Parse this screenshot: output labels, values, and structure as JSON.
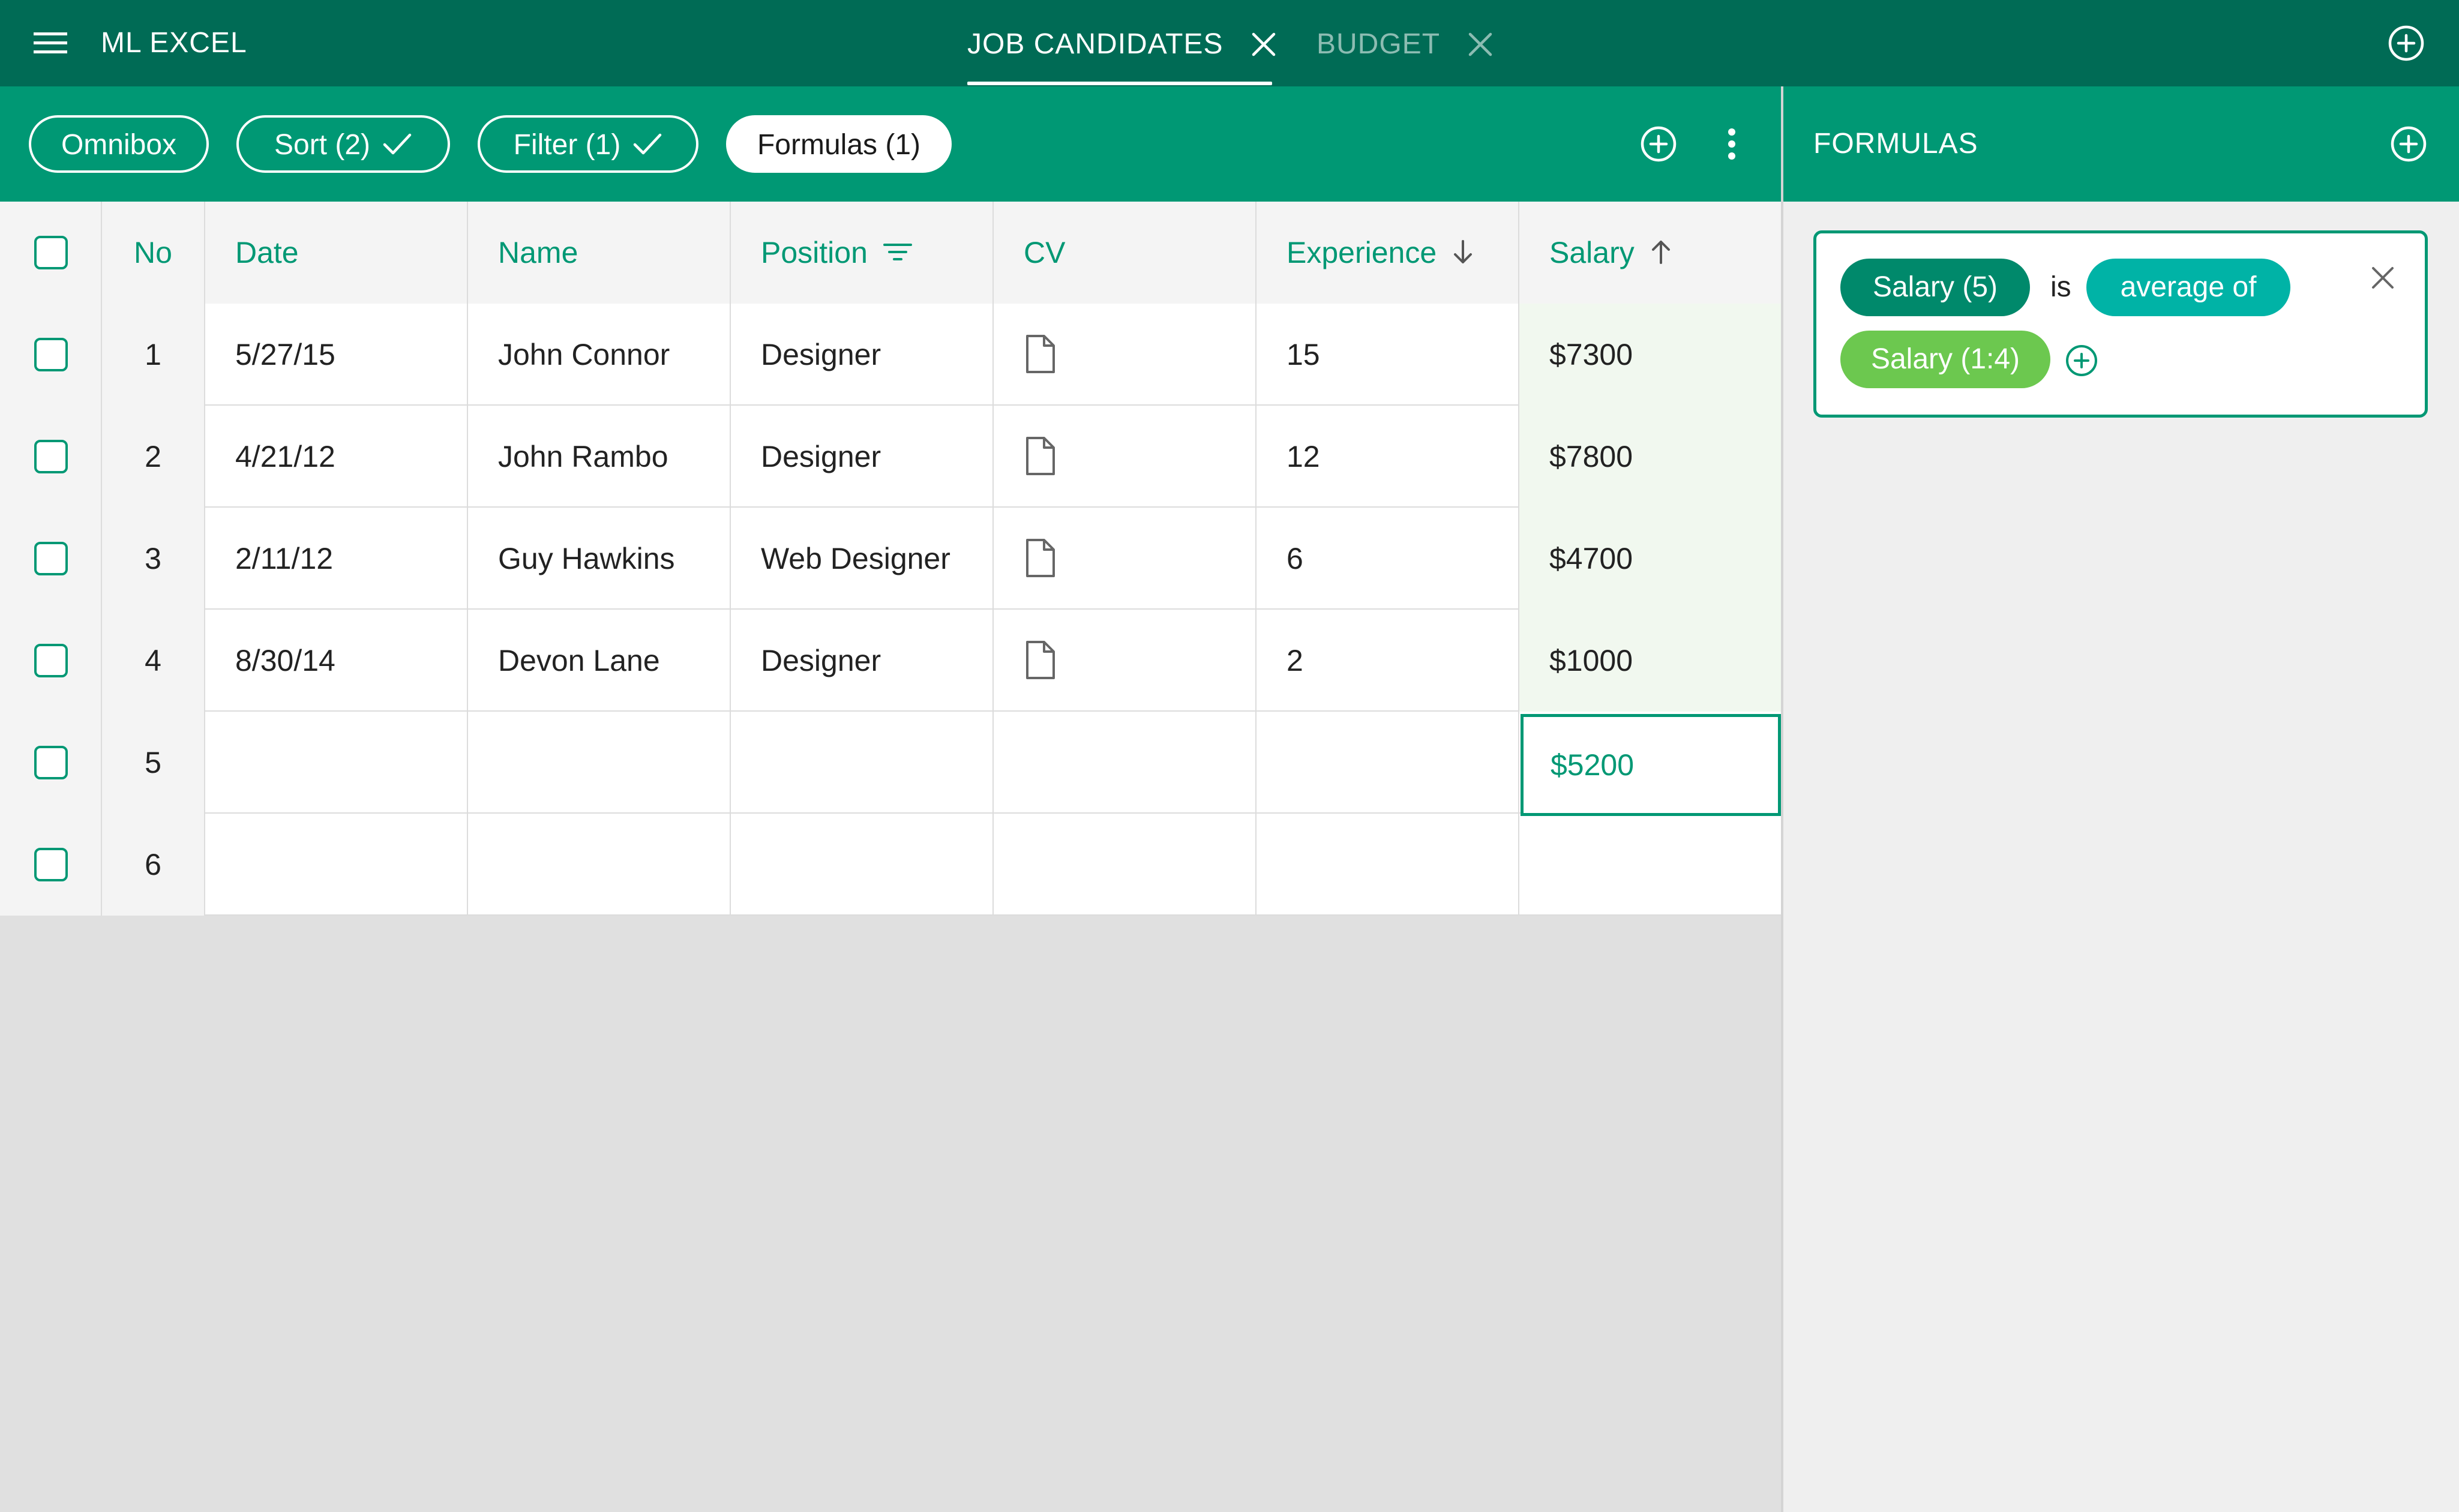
{
  "app": {
    "title": "ML EXCEL"
  },
  "tabs": [
    {
      "label": "JOB CANDIDATES",
      "active": true
    },
    {
      "label": "BUDGET",
      "active": false
    }
  ],
  "toolbar": {
    "omnibox_label": "Omnibox",
    "sort_label": "Sort (2)",
    "filter_label": "Filter (1)",
    "formulas_label": "Formulas (1)"
  },
  "table": {
    "columns": [
      "No",
      "Date",
      "Name",
      "Position",
      "CV",
      "Experience",
      "Salary"
    ],
    "rows": [
      {
        "no": "1",
        "date": "5/27/15",
        "name": "John Connor",
        "position": "Designer",
        "experience": "15",
        "salary": "$7300"
      },
      {
        "no": "2",
        "date": "4/21/12",
        "name": "John Rambo",
        "position": "Designer",
        "experience": "12",
        "salary": "$7800"
      },
      {
        "no": "3",
        "date": "2/11/12",
        "name": "Guy Hawkins",
        "position": "Web Designer",
        "experience": "6",
        "salary": "$4700"
      },
      {
        "no": "4",
        "date": "8/30/14",
        "name": "Devon Lane",
        "position": "Designer",
        "experience": "2",
        "salary": "$1000"
      },
      {
        "no": "5",
        "date": "",
        "name": "",
        "position": "",
        "experience": "",
        "salary": "$5200"
      },
      {
        "no": "6",
        "date": "",
        "name": "",
        "position": "",
        "experience": "",
        "salary": ""
      }
    ]
  },
  "formulas_panel": {
    "title": "FORMULAS",
    "formula": {
      "target": "Salary (5)",
      "connector": "is",
      "operation": "average of",
      "range": "Salary (1:4)"
    }
  },
  "colors": {
    "topbar": "#006b55",
    "accent": "#009874",
    "chip_operation": "#00b3a6",
    "chip_range": "#6cc84f",
    "highlight_cell": "#f1f8ef"
  },
  "icons": {
    "menu": "menu-icon",
    "close": "close-icon",
    "add": "add-circle-icon",
    "check": "check-icon",
    "more": "more-vert-icon",
    "filter": "filter-lines-icon",
    "sort_down": "arrow-down-icon",
    "sort_up": "arrow-up-icon",
    "document": "document-icon"
  }
}
